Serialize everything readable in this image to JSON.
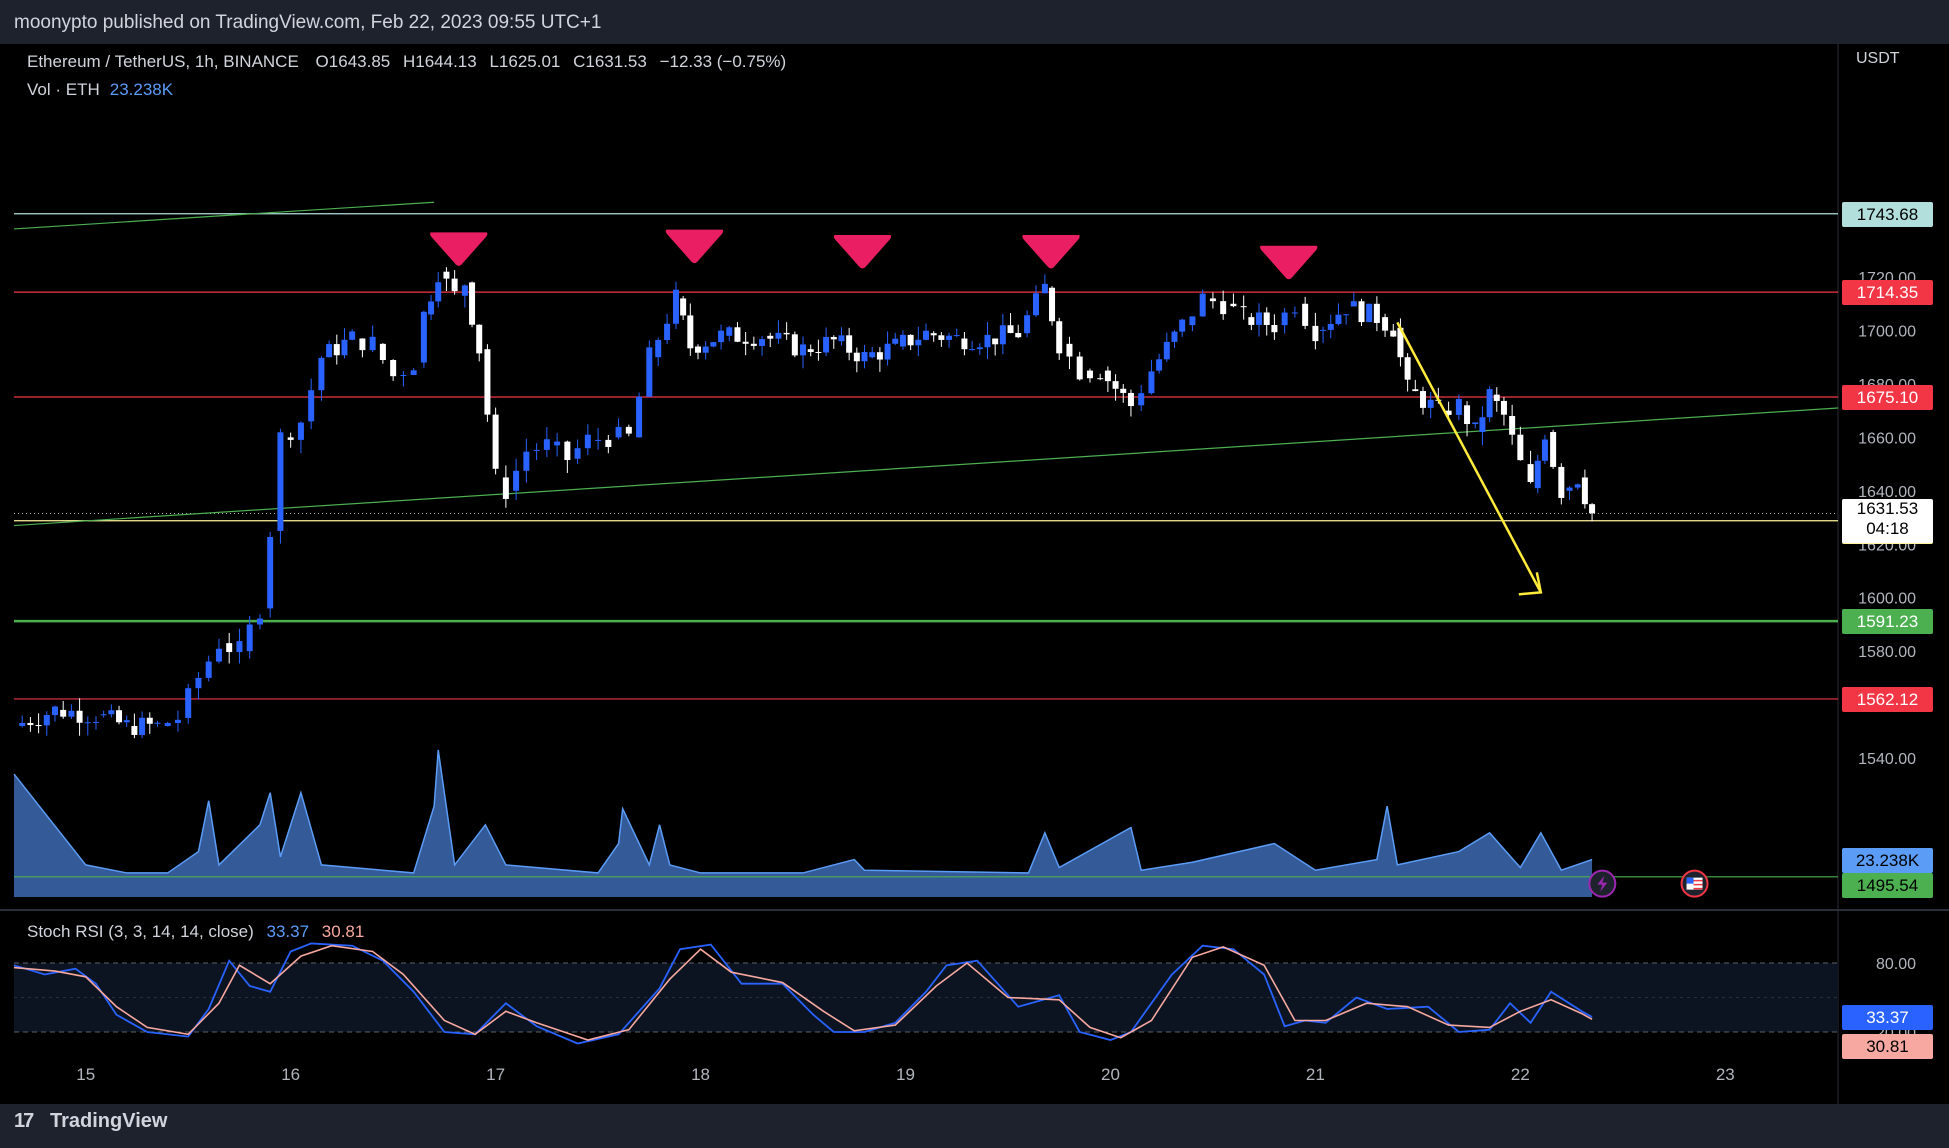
{
  "publisher": "moonypto published on TradingView.com, Feb 22, 2023 09:55 UTC+1",
  "brand": "TradingView",
  "symbol": {
    "pair": "Ethereum / TetherUS, 1h, BINANCE",
    "open_label": "O",
    "open": "1643.85",
    "high_label": "H",
    "high": "1644.13",
    "low_label": "L",
    "low": "1625.01",
    "close_label": "C",
    "close": "1631.53",
    "change": "−12.33 (−0.75%)"
  },
  "volume": {
    "label": "Vol · ETH",
    "value": "23.238K"
  },
  "rsi": {
    "label": "Stoch RSI (3, 3, 14, 14, close)",
    "k": "33.37",
    "d": "30.81"
  },
  "price_axis_unit": "USDT",
  "colors": {
    "up": "#2962ff",
    "down": "#ffffff",
    "resistance": "#f23645",
    "support": "#4caf50",
    "arrow": "#ffeb3b",
    "marker": "#e91e63"
  },
  "chart_data": {
    "type": "candlestick",
    "x_ticks": [
      "15",
      "16",
      "17",
      "18",
      "19",
      "20",
      "21",
      "22",
      "23"
    ],
    "y_ticks": [
      "1540.00",
      "1560.00",
      "1580.00",
      "1600.00",
      "1620.00",
      "1640.00",
      "1660.00",
      "1680.00",
      "1700.00",
      "1720.00"
    ],
    "ylim": [
      1485,
      1790
    ],
    "x_range": [
      14.65,
      23.55
    ],
    "horizontal_levels": [
      {
        "value": 1743.68,
        "label": "1743.68",
        "color": "#b2dfdb"
      },
      {
        "value": 1714.35,
        "label": "1714.35",
        "color": "#f23645"
      },
      {
        "value": 1675.1,
        "label": "1675.10",
        "color": "#f23645"
      },
      {
        "value": 1628.8,
        "label": "1628.80",
        "color": "#fff59d"
      },
      {
        "value": 1591.23,
        "label": "1591.23",
        "color": "#4caf50"
      },
      {
        "value": 1562.12,
        "label": "1562.12",
        "color": "#f23645"
      },
      {
        "value": 1495.54,
        "label": "1495.54",
        "color": "#4caf50"
      }
    ],
    "last_price": {
      "value": 1631.53,
      "label": "1631.53",
      "countdown": "04:18"
    },
    "volume_badge": "23.238K",
    "trendlines": [
      {
        "from": [
          14.65,
          1738
        ],
        "to": [
          16.7,
          1748
        ],
        "color": "#4caf50"
      },
      {
        "from": [
          14.65,
          1627
        ],
        "to": [
          23.55,
          1671
        ],
        "color": "#4caf50"
      }
    ],
    "arrow": {
      "from": [
        21.4,
        1703
      ],
      "to": [
        22.1,
        1602
      ],
      "color": "#ffeb3b"
    },
    "markers": [
      {
        "x": 16.82,
        "y": 1730
      },
      {
        "x": 17.97,
        "y": 1731
      },
      {
        "x": 18.79,
        "y": 1729
      },
      {
        "x": 19.71,
        "y": 1729
      },
      {
        "x": 20.87,
        "y": 1725
      }
    ],
    "path_points": [
      [
        14.65,
        1552
      ],
      [
        14.85,
        1558
      ],
      [
        15.05,
        1556
      ],
      [
        15.2,
        1552
      ],
      [
        15.35,
        1552
      ],
      [
        15.45,
        1555
      ],
      [
        15.55,
        1570
      ],
      [
        15.65,
        1583
      ],
      [
        15.75,
        1580
      ],
      [
        15.85,
        1596
      ],
      [
        15.9,
        1625
      ],
      [
        15.95,
        1660
      ],
      [
        16.05,
        1666
      ],
      [
        16.15,
        1690
      ],
      [
        16.3,
        1697
      ],
      [
        16.4,
        1695
      ],
      [
        16.5,
        1683
      ],
      [
        16.6,
        1688
      ],
      [
        16.65,
        1706
      ],
      [
        16.72,
        1722
      ],
      [
        16.8,
        1713
      ],
      [
        16.85,
        1718
      ],
      [
        16.92,
        1693
      ],
      [
        17.0,
        1645
      ],
      [
        17.05,
        1640
      ],
      [
        17.15,
        1655
      ],
      [
        17.25,
        1657
      ],
      [
        17.35,
        1652
      ],
      [
        17.45,
        1659
      ],
      [
        17.55,
        1660
      ],
      [
        17.65,
        1660
      ],
      [
        17.75,
        1690
      ],
      [
        17.88,
        1712
      ],
      [
        17.95,
        1694
      ],
      [
        18.1,
        1698
      ],
      [
        18.3,
        1698
      ],
      [
        18.5,
        1693
      ],
      [
        18.65,
        1696
      ],
      [
        18.8,
        1690
      ],
      [
        18.95,
        1694
      ],
      [
        19.1,
        1699
      ],
      [
        19.25,
        1697
      ],
      [
        19.4,
        1697
      ],
      [
        19.55,
        1699
      ],
      [
        19.68,
        1716
      ],
      [
        19.75,
        1695
      ],
      [
        19.85,
        1685
      ],
      [
        19.95,
        1685
      ],
      [
        20.1,
        1672
      ],
      [
        20.2,
        1685
      ],
      [
        20.35,
        1702
      ],
      [
        20.45,
        1712
      ],
      [
        20.55,
        1710
      ],
      [
        20.65,
        1705
      ],
      [
        20.8,
        1702
      ],
      [
        20.9,
        1710
      ],
      [
        21.0,
        1700
      ],
      [
        21.15,
        1709
      ],
      [
        21.3,
        1705
      ],
      [
        21.38,
        1701
      ],
      [
        21.45,
        1678
      ],
      [
        21.6,
        1670
      ],
      [
        21.7,
        1672
      ],
      [
        21.78,
        1662
      ],
      [
        21.85,
        1676
      ],
      [
        21.92,
        1668
      ],
      [
        22.0,
        1650
      ],
      [
        22.05,
        1641
      ],
      [
        22.12,
        1662
      ],
      [
        22.2,
        1640
      ],
      [
        22.28,
        1645
      ],
      [
        22.35,
        1631.5
      ]
    ],
    "volume_points": [
      [
        14.65,
        1534
      ],
      [
        15.0,
        1500
      ],
      [
        15.2,
        1497
      ],
      [
        15.4,
        1497
      ],
      [
        15.55,
        1505
      ],
      [
        15.6,
        1524
      ],
      [
        15.65,
        1500
      ],
      [
        15.85,
        1515
      ],
      [
        15.9,
        1527
      ],
      [
        15.95,
        1503
      ],
      [
        16.05,
        1527
      ],
      [
        16.15,
        1500
      ],
      [
        16.6,
        1497
      ],
      [
        16.7,
        1522
      ],
      [
        16.72,
        1543
      ],
      [
        16.8,
        1500
      ],
      [
        16.95,
        1515
      ],
      [
        17.05,
        1500
      ],
      [
        17.5,
        1497
      ],
      [
        17.6,
        1508
      ],
      [
        17.62,
        1521
      ],
      [
        17.75,
        1500
      ],
      [
        17.8,
        1515
      ],
      [
        17.85,
        1500
      ],
      [
        18.0,
        1497
      ],
      [
        18.5,
        1497
      ],
      [
        18.75,
        1502
      ],
      [
        18.8,
        1498
      ],
      [
        19.6,
        1497
      ],
      [
        19.68,
        1512
      ],
      [
        19.75,
        1499
      ],
      [
        20.1,
        1514
      ],
      [
        20.15,
        1498
      ],
      [
        20.4,
        1501
      ],
      [
        20.8,
        1508
      ],
      [
        21.0,
        1498
      ],
      [
        21.3,
        1502
      ],
      [
        21.35,
        1522
      ],
      [
        21.4,
        1500
      ],
      [
        21.7,
        1505
      ],
      [
        21.85,
        1512
      ],
      [
        22.0,
        1499
      ],
      [
        22.1,
        1512
      ],
      [
        22.2,
        1498
      ],
      [
        22.35,
        1502
      ]
    ],
    "rsi_ticks": [
      "80.00",
      "20.00"
    ],
    "rsi_k_points": [
      [
        14.65,
        78
      ],
      [
        14.8,
        70
      ],
      [
        14.95,
        75
      ],
      [
        15.05,
        62
      ],
      [
        15.15,
        35
      ],
      [
        15.3,
        20
      ],
      [
        15.5,
        16
      ],
      [
        15.6,
        40
      ],
      [
        15.7,
        82
      ],
      [
        15.8,
        60
      ],
      [
        15.9,
        55
      ],
      [
        16.0,
        90
      ],
      [
        16.1,
        97
      ],
      [
        16.3,
        95
      ],
      [
        16.45,
        82
      ],
      [
        16.6,
        55
      ],
      [
        16.75,
        20
      ],
      [
        16.9,
        18
      ],
      [
        17.05,
        45
      ],
      [
        17.2,
        25
      ],
      [
        17.4,
        10
      ],
      [
        17.6,
        18
      ],
      [
        17.8,
        58
      ],
      [
        17.9,
        92
      ],
      [
        18.05,
        96
      ],
      [
        18.2,
        62
      ],
      [
        18.4,
        62
      ],
      [
        18.55,
        35
      ],
      [
        18.65,
        20
      ],
      [
        18.8,
        20
      ],
      [
        18.95,
        28
      ],
      [
        19.1,
        55
      ],
      [
        19.2,
        78
      ],
      [
        19.35,
        82
      ],
      [
        19.55,
        42
      ],
      [
        19.75,
        52
      ],
      [
        19.85,
        20
      ],
      [
        20.0,
        13
      ],
      [
        20.1,
        20
      ],
      [
        20.3,
        70
      ],
      [
        20.45,
        95
      ],
      [
        20.6,
        92
      ],
      [
        20.75,
        70
      ],
      [
        20.85,
        25
      ],
      [
        20.95,
        30
      ],
      [
        21.05,
        28
      ],
      [
        21.2,
        50
      ],
      [
        21.35,
        40
      ],
      [
        21.55,
        42
      ],
      [
        21.7,
        20
      ],
      [
        21.85,
        22
      ],
      [
        21.95,
        45
      ],
      [
        22.05,
        28
      ],
      [
        22.15,
        55
      ],
      [
        22.3,
        38
      ],
      [
        22.35,
        33
      ]
    ],
    "rsi_d_points": [
      [
        14.65,
        76
      ],
      [
        14.85,
        73
      ],
      [
        15.0,
        68
      ],
      [
        15.15,
        42
      ],
      [
        15.3,
        24
      ],
      [
        15.5,
        18
      ],
      [
        15.65,
        45
      ],
      [
        15.75,
        78
      ],
      [
        15.9,
        62
      ],
      [
        16.05,
        86
      ],
      [
        16.2,
        95
      ],
      [
        16.4,
        90
      ],
      [
        16.55,
        70
      ],
      [
        16.75,
        30
      ],
      [
        16.9,
        18
      ],
      [
        17.05,
        38
      ],
      [
        17.2,
        28
      ],
      [
        17.45,
        13
      ],
      [
        17.65,
        22
      ],
      [
        17.85,
        66
      ],
      [
        18.0,
        92
      ],
      [
        18.15,
        72
      ],
      [
        18.4,
        63
      ],
      [
        18.6,
        38
      ],
      [
        18.75,
        21
      ],
      [
        18.95,
        26
      ],
      [
        19.15,
        60
      ],
      [
        19.3,
        80
      ],
      [
        19.5,
        50
      ],
      [
        19.75,
        48
      ],
      [
        19.9,
        24
      ],
      [
        20.05,
        15
      ],
      [
        20.2,
        30
      ],
      [
        20.4,
        85
      ],
      [
        20.55,
        94
      ],
      [
        20.75,
        78
      ],
      [
        20.9,
        30
      ],
      [
        21.05,
        30
      ],
      [
        21.25,
        45
      ],
      [
        21.45,
        42
      ],
      [
        21.65,
        26
      ],
      [
        21.85,
        24
      ],
      [
        22.0,
        38
      ],
      [
        22.15,
        48
      ],
      [
        22.3,
        36
      ],
      [
        22.35,
        31
      ]
    ]
  }
}
